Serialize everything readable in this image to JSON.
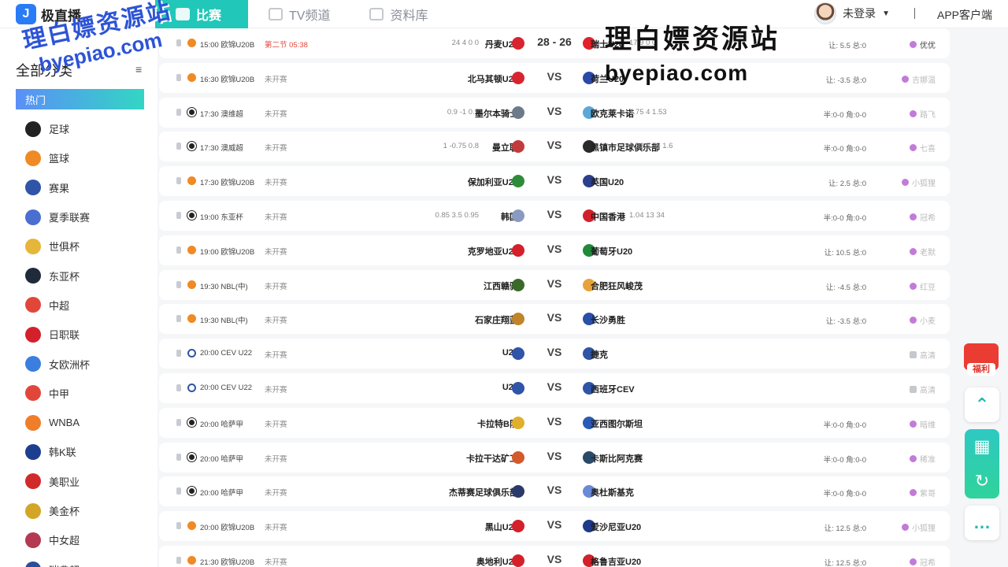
{
  "header": {
    "logo_mark": "J",
    "logo_text": "极直播",
    "nav": [
      {
        "label": "比赛",
        "active": true,
        "icon": "trophy-icon"
      },
      {
        "label": "TV频道",
        "active": false,
        "icon": "tv-icon"
      },
      {
        "label": "资料库",
        "active": false,
        "icon": "chart-icon"
      }
    ],
    "user_label": "未登录",
    "app_link": "APP客户端"
  },
  "watermark": {
    "text": "理白嫖资源站",
    "url": "byepiao.com"
  },
  "sidebar": {
    "title": "全部分类",
    "menu_icon": "≡",
    "items": [
      {
        "label": "热门",
        "active": true,
        "color": "#ffffff"
      },
      {
        "label": "足球",
        "color": "#222222"
      },
      {
        "label": "篮球",
        "color": "#f08a24"
      },
      {
        "label": "赛果",
        "color": "#2f54a8"
      },
      {
        "label": "夏季联赛",
        "color": "#4a6fd1"
      },
      {
        "label": "世俱杯",
        "color": "#e6b63a"
      },
      {
        "label": "东亚杯",
        "color": "#1f2a3a"
      },
      {
        "label": "中超",
        "color": "#e2463b"
      },
      {
        "label": "日职联",
        "color": "#d3202a"
      },
      {
        "label": "女欧洲杯",
        "color": "#3a7fe0"
      },
      {
        "label": "中甲",
        "color": "#e2463b"
      },
      {
        "label": "WNBA",
        "color": "#f07d2a"
      },
      {
        "label": "韩K联",
        "color": "#1d3f8f"
      },
      {
        "label": "美职业",
        "color": "#d12a2a"
      },
      {
        "label": "美金杯",
        "color": "#d4a627"
      },
      {
        "label": "中女超",
        "color": "#b33a52"
      },
      {
        "label": "瑞典超",
        "color": "#2a4f9a"
      }
    ]
  },
  "matches": [
    {
      "sport": "basketball",
      "time": "15:00 欧锦U20B",
      "status": "第二节  05:38",
      "live": true,
      "left_odds": "24  4  0  0",
      "home": "丹麦U20",
      "home_color": "#d8242f",
      "vs": "28 - 26",
      "score": true,
      "away": "瑞士U20",
      "away_color": "#e2202a",
      "right_odds": "17  9  0  0",
      "handicap": "让: 5.5   总:0",
      "anchor": "优优",
      "anchor_strong": true,
      "anchor_type": "host"
    },
    {
      "sport": "basketball",
      "time": "16:30 欧锦U20B",
      "status": "未开赛",
      "left_odds": "",
      "home": "北马其顿U20",
      "home_color": "#d8242f",
      "vs": "VS",
      "away": "荷兰U20",
      "away_color": "#2b4aa8",
      "right_odds": "",
      "handicap": "让: -3.5   总:0",
      "anchor": "吉娜温",
      "anchor_type": "host"
    },
    {
      "sport": "football",
      "time": "17:30 澳维超",
      "status": "未开赛",
      "left_odds": "0.9  -1  0.9",
      "home": "墨尔本骑士",
      "home_color": "#6c7a8a",
      "vs": "VS",
      "away": "欧克莱卡诺",
      "away_color": "#5aa8d8",
      "right_odds": "4.75  4  1.53",
      "handicap": "半:0-0   角:0-0",
      "anchor": "路飞",
      "anchor_type": "host"
    },
    {
      "sport": "football",
      "time": "17:30 澳威超",
      "status": "未开赛",
      "left_odds": "1  -0.75  0.8",
      "home": "曼立联",
      "home_color": "#c23a3a",
      "vs": "VS",
      "away": "黑镇市足球俱乐部",
      "away_color": "#2a2a2a",
      "right_odds": "4.33  3.75  1.6",
      "handicap": "半:0-0   角:0-0",
      "anchor": "七喜",
      "anchor_type": "host"
    },
    {
      "sport": "basketball",
      "time": "17:30 欧锦U20B",
      "status": "未开赛",
      "left_odds": "",
      "home": "保加利亚U20",
      "home_color": "#2e8b3a",
      "vs": "VS",
      "away": "英国U20",
      "away_color": "#2b3f8f",
      "right_odds": "",
      "handicap": "让: 2.5   总:0",
      "anchor": "小狐狸",
      "anchor_type": "host"
    },
    {
      "sport": "football",
      "time": "19:00 东亚杯",
      "status": "未开赛",
      "left_odds": "0.85  3.5  0.95",
      "home": "韩国",
      "home_color": "#8a9ac0",
      "vs": "VS",
      "away": "中国香港",
      "away_color": "#d3202a",
      "right_odds": "1.04  13  34",
      "handicap": "半:0-0   角:0-0",
      "anchor": "冠希",
      "anchor_type": "host"
    },
    {
      "sport": "basketball",
      "time": "19:00 欧锦U20B",
      "status": "未开赛",
      "left_odds": "",
      "home": "克罗地亚U20",
      "home_color": "#d3202a",
      "vs": "VS",
      "away": "葡萄牙U20",
      "away_color": "#1f8a3a",
      "right_odds": "",
      "handicap": "让: 10.5   总:0",
      "anchor": "老默",
      "anchor_type": "host"
    },
    {
      "sport": "basketball",
      "time": "19:30 NBL(中)",
      "status": "未开赛",
      "left_odds": "",
      "home": "江西赣驰",
      "home_color": "#3a6a2a",
      "vs": "VS",
      "away": "合肥狂风峻茂",
      "away_color": "#e8a23a",
      "right_odds": "",
      "handicap": "让: -4.5   总:0",
      "anchor": "红豆",
      "anchor_type": "host"
    },
    {
      "sport": "basketball",
      "time": "19:30 NBL(中)",
      "status": "未开赛",
      "left_odds": "",
      "home": "石家庄翔蓝",
      "home_color": "#c0852a",
      "vs": "VS",
      "away": "长沙勇胜",
      "away_color": "#2a4fa8",
      "right_odds": "",
      "handicap": "让: -3.5   总:0",
      "anchor": "小麦",
      "anchor_type": "host"
    },
    {
      "sport": "volleyball",
      "time": "20:00 CEV U22",
      "status": "未开赛",
      "left_odds": "",
      "home": "U22",
      "home_color": "#2f54a8",
      "vs": "VS",
      "away": "捷克",
      "away_color": "#2f54a8",
      "right_odds": "",
      "handicap": "",
      "anchor": "高清",
      "anchor_type": "tv"
    },
    {
      "sport": "volleyball",
      "time": "20:00 CEV U22",
      "status": "未开赛",
      "left_odds": "",
      "home": "U22",
      "home_color": "#2f54a8",
      "vs": "VS",
      "away": "西班牙CEV",
      "away_color": "#2f54a8",
      "right_odds": "",
      "handicap": "",
      "anchor": "高清",
      "anchor_type": "tv"
    },
    {
      "sport": "football",
      "time": "20:00 哈萨甲",
      "status": "未开赛",
      "left_odds": "",
      "home": "卡拉特B队",
      "home_color": "#e0b02a",
      "vs": "VS",
      "away": "亚西图尔斯坦",
      "away_color": "#2a5ab8",
      "right_odds": "",
      "handicap": "半:0-0   角:0-0",
      "anchor": "暗维",
      "anchor_type": "host"
    },
    {
      "sport": "football",
      "time": "20:00 哈萨甲",
      "status": "未开赛",
      "left_odds": "",
      "home": "卡拉干达矿工",
      "home_color": "#d35a2a",
      "vs": "VS",
      "away": "卡斯比阿克赛",
      "away_color": "#2a4a6a",
      "right_odds": "",
      "handicap": "半:0-0   角:0-0",
      "anchor": "稀准",
      "anchor_type": "host"
    },
    {
      "sport": "football",
      "time": "20:00 哈萨甲",
      "status": "未开赛",
      "left_odds": "",
      "home": "杰蒂赛足球俱乐部",
      "home_color": "#2a3a6a",
      "vs": "VS",
      "away": "奥杜斯基克",
      "away_color": "#6a8ad8",
      "right_odds": "",
      "handicap": "半:0-0   角:0-0",
      "anchor": "紫哥",
      "anchor_type": "host"
    },
    {
      "sport": "basketball",
      "time": "20:00 欧锦U20B",
      "status": "未开赛",
      "left_odds": "",
      "home": "黑山U20",
      "home_color": "#d3202a",
      "vs": "VS",
      "away": "爱沙尼亚U20",
      "away_color": "#1f3a8a",
      "right_odds": "",
      "handicap": "让: 12.5   总:0",
      "anchor": "小狐狸",
      "anchor_type": "host"
    },
    {
      "sport": "basketball",
      "time": "21:30 欧锦U20B",
      "status": "未开赛",
      "left_odds": "",
      "home": "奥地利U20",
      "home_color": "#d3202a",
      "vs": "VS",
      "away": "格鲁吉亚U20",
      "away_color": "#d3202a",
      "right_odds": "",
      "handicap": "让: 12.5   总:0",
      "anchor": "冠希",
      "anchor_type": "host"
    }
  ],
  "float": {
    "gift_label": "福利",
    "top_icon": "⌃",
    "qr_icon": "▦",
    "refresh_icon": "↻",
    "chat_icon": "…"
  }
}
